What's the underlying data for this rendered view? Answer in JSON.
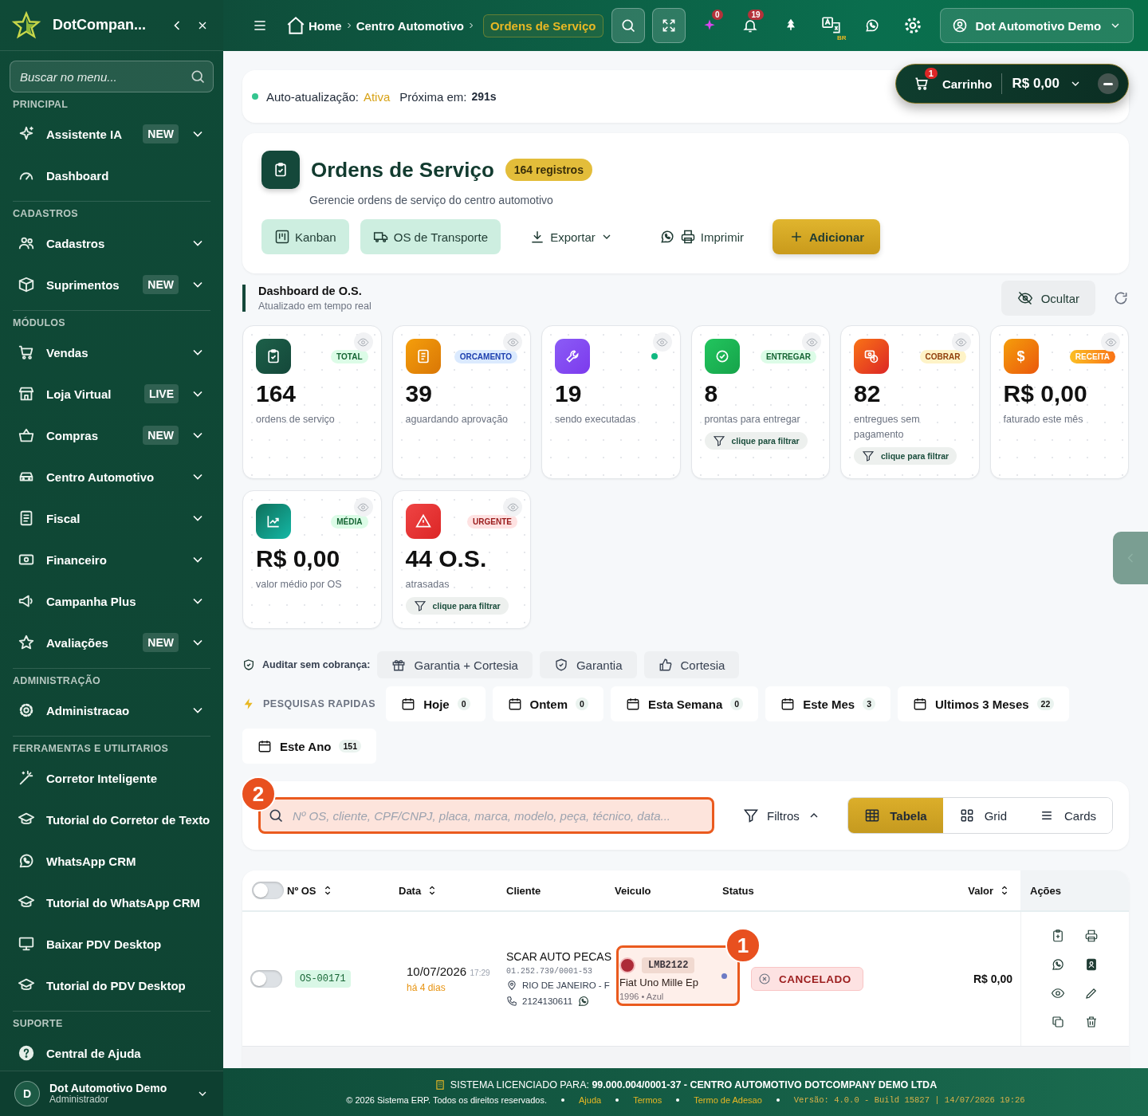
{
  "sidebar": {
    "brand": "DotCompan...",
    "search": {
      "placeholder": "Buscar no menu..."
    },
    "sections": [
      {
        "title": "PRINCIPAL",
        "items": [
          {
            "label": "Assistente IA",
            "badge": "NEW",
            "has_submenu": true
          },
          {
            "label": "Dashboard"
          }
        ]
      },
      {
        "title": "CADASTROS",
        "items": [
          {
            "label": "Cadastros",
            "has_submenu": true
          },
          {
            "label": "Suprimentos",
            "badge": "NEW",
            "has_submenu": true
          }
        ]
      },
      {
        "title": "MÓDULOS",
        "items": [
          {
            "label": "Vendas",
            "has_submenu": true
          },
          {
            "label": "Loja Virtual",
            "badge": "LIVE",
            "has_submenu": true
          },
          {
            "label": "Compras",
            "badge": "NEW",
            "has_submenu": true
          },
          {
            "label": "Centro Automotivo",
            "has_submenu": true
          },
          {
            "label": "Fiscal",
            "has_submenu": true
          },
          {
            "label": "Financeiro",
            "has_submenu": true
          },
          {
            "label": "Campanha Plus",
            "has_submenu": true
          },
          {
            "label": "Avaliações",
            "badge": "NEW",
            "has_submenu": true
          }
        ]
      },
      {
        "title": "ADMINISTRAÇÃO",
        "items": [
          {
            "label": "Administracao",
            "has_submenu": true
          }
        ]
      },
      {
        "title": "FERRAMENTAS E UTILITARIOS",
        "items": [
          {
            "label": "Corretor Inteligente"
          },
          {
            "label": "Tutorial do Corretor de Texto"
          },
          {
            "label": "WhatsApp CRM"
          },
          {
            "label": "Tutorial do WhatsApp CRM"
          },
          {
            "label": "Baixar PDV Desktop"
          },
          {
            "label": "Tutorial do PDV Desktop"
          }
        ]
      },
      {
        "title": "SUPORTE",
        "items": [
          {
            "label": "Central de Ajuda"
          }
        ]
      }
    ],
    "user": {
      "initial": "D",
      "name": "Dot Automotivo Demo",
      "role": "Administrador"
    }
  },
  "topbar": {
    "breadcrumb": [
      {
        "label": "Home",
        "selected": false
      },
      {
        "label": "Centro Automotivo",
        "selected": false
      },
      {
        "label": "Ordens de Serviço",
        "selected": true
      }
    ],
    "ai_count": "0",
    "notification_count": "19",
    "language": "BR",
    "user": "Dot Automotivo Demo"
  },
  "auto_update": {
    "label": "Auto-atualização:",
    "status": "Ativa",
    "next_label": "Próxima em:",
    "countdown": "291s"
  },
  "cart": {
    "count": "1",
    "label": "Carrinho",
    "total": "R$ 0,00"
  },
  "header": {
    "title": "Ordens de Serviço",
    "count": "164 registros",
    "subtitle": "Gerencie ordens de serviço do centro automotivo",
    "actions": [
      {
        "label": "Kanban",
        "kind": "soft"
      },
      {
        "label": "OS de Transporte",
        "kind": "soft"
      },
      {
        "label": "Exportar",
        "kind": "export"
      },
      {
        "label": "Imprimir",
        "kind": "print"
      },
      {
        "label": "Adicionar",
        "kind": "primary"
      }
    ]
  },
  "dashboard": {
    "title": "Dashboard de O.S.",
    "subtitle": "Atualizado em tempo real",
    "hide_label": "Ocultar",
    "cards": [
      {
        "kind": "total",
        "tag": "TOTAL",
        "value": "164",
        "label": "ordens de serviço"
      },
      {
        "kind": "quote",
        "tag": "ORCAMENTO",
        "value": "39",
        "label": "aguardando aprovação"
      },
      {
        "kind": "running",
        "live": true,
        "value": "19",
        "label": "sendo executadas"
      },
      {
        "kind": "deliver",
        "tag": "ENTREGAR",
        "value": "8",
        "label": "prontas para entregar",
        "filter": "clique para filtrar"
      },
      {
        "kind": "charge",
        "tag": "COBRAR",
        "value": "82",
        "label": "entregues sem pagamento",
        "filter": "clique para filtrar"
      },
      {
        "kind": "revenue",
        "tag": "RECEITA",
        "glyph": "$",
        "value": "R$ 0,00",
        "label": "faturado este mês"
      },
      {
        "kind": "average",
        "tag": "MÉDIA",
        "value": "R$ 0,00",
        "label": "valor médio por OS"
      },
      {
        "kind": "urgent",
        "tag": "URGENTE",
        "value": "44 O.S.",
        "label": "atrasadas",
        "filter": "clique para filtrar"
      }
    ]
  },
  "audit": {
    "label": "Auditar sem cobrança:",
    "options": [
      "Garantia + Cortesia",
      "Garantia",
      "Cortesia"
    ]
  },
  "quick_search": {
    "label": "PESQUISAS RAPIDAS",
    "items": [
      {
        "label": "Hoje",
        "count": "0"
      },
      {
        "label": "Ontem",
        "count": "0"
      },
      {
        "label": "Esta Semana",
        "count": "0"
      },
      {
        "label": "Este Mes",
        "count": "3"
      },
      {
        "label": "Ultimos 3 Meses",
        "count": "22"
      },
      {
        "label": "Este Ano",
        "count": "151"
      }
    ]
  },
  "search": {
    "step": "2",
    "placeholder": "Nº OS, cliente, CPF/CNPJ, placa, marca, modelo, peça, técnico, data...",
    "filters": "Filtros",
    "views": [
      {
        "label": "Tabela",
        "selected": true
      },
      {
        "label": "Grid",
        "selected": false
      },
      {
        "label": "Cards",
        "selected": false
      }
    ]
  },
  "table": {
    "select_all": false,
    "columns": [
      {
        "label": "Nº OS",
        "sortable": true
      },
      {
        "label": "Data",
        "sortable": true
      },
      {
        "label": "Cliente",
        "sortable": false
      },
      {
        "label": "Veiculo",
        "sortable": false
      },
      {
        "label": "Status",
        "sortable": false
      },
      {
        "label": "Valor",
        "sortable": true
      },
      {
        "label": "Ações",
        "sortable": false
      }
    ],
    "rows": [
      {
        "checked": false,
        "os": "OS-00171",
        "date": "10/07/2026",
        "time": "17:29",
        "ago": "há 4 dias",
        "client": "SCAR AUTO PECAS",
        "document": "01.252.739/0001-53",
        "city": "RIO DE JANEIRO - F",
        "phone": "2124130611",
        "plate": "LMB2122",
        "vehicle": "Fiat Uno Mille Ep",
        "vehicle_detail": "1996 • Azul",
        "step": "1",
        "status": "CANCELADO",
        "value": "R$ 0,00"
      }
    ]
  },
  "footer": {
    "license": "SISTEMA LICENCIADO PARA: **99.000.004/0001-37 - CENTRO AUTOMOTIVO DOTCOMPANY DEMO LTDA**",
    "copyright": "© 2026 Sistema ERP. Todos os direitos reservados.",
    "links": [
      "Ajuda",
      "Termos",
      "Termo de Adesao"
    ],
    "version": "Versão: 4.0.0 - Build 15827 | 14/07/2026 19:26"
  }
}
